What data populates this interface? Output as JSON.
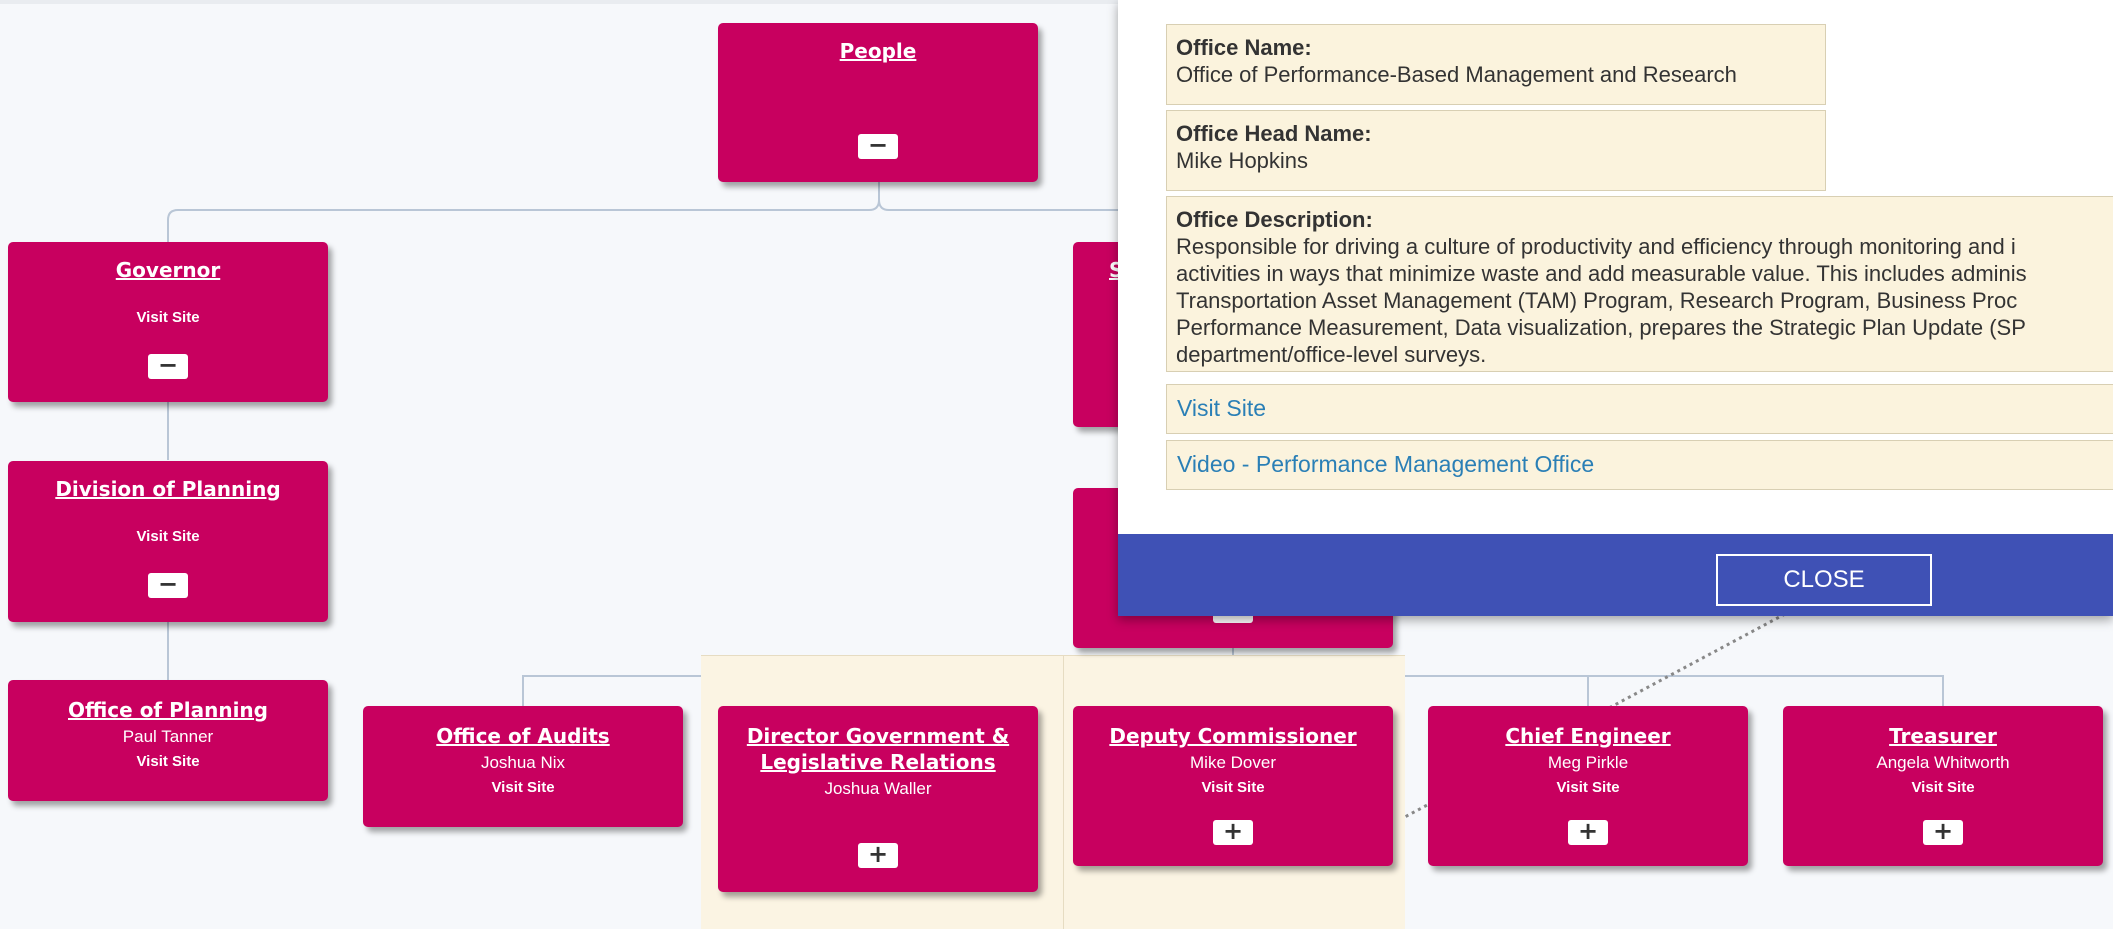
{
  "chart": {
    "nodes": {
      "people": {
        "title": "People",
        "toggle": "−"
      },
      "governor": {
        "title": "Governor",
        "visit": "Visit Site",
        "toggle": "−"
      },
      "planning_div": {
        "title": "Division of Planning",
        "visit": "Visit Site",
        "toggle": "−"
      },
      "planning_office": {
        "title": "Office of Planning",
        "head": "Paul Tanner",
        "visit": "Visit Site"
      },
      "audits": {
        "title": "Office of Audits",
        "head": "Joshua Nix",
        "visit": "Visit Site"
      },
      "gov_relations": {
        "title": "Director Government & Legislative Relations",
        "head": "Joshua Waller",
        "toggle": "+"
      },
      "deputy": {
        "title": "Deputy Commissioner",
        "head": "Mike Dover",
        "visit": "Visit Site",
        "toggle": "+"
      },
      "chief_engineer": {
        "title": "Chief Engineer",
        "head": "Meg Pirkle",
        "visit": "Visit Site",
        "toggle": "+"
      },
      "treasurer": {
        "title": "Treasurer",
        "head": "Angela Whitworth",
        "visit": "Visit Site",
        "toggle": "+"
      },
      "partial_s": {
        "title": "S"
      }
    }
  },
  "modal": {
    "office_name": {
      "label": "Office Name:",
      "value": "Office of Performance-Based Management and Research"
    },
    "office_head": {
      "label": "Office Head Name:",
      "value": "Mike Hopkins"
    },
    "office_desc": {
      "label": "Office Description:",
      "lines": [
        "Responsible for driving a culture of productivity and efficiency through monitoring and i",
        "activities in ways that minimize waste and add measurable value. This includes adminis",
        "Transportation Asset Management (TAM) Program, Research Program, Business Proc",
        "Performance Measurement, Data visualization, prepares the Strategic Plan Update (SP",
        "department/office-level surveys."
      ]
    },
    "visit_link": "Visit Site",
    "video_link": "Video - Performance Management Office",
    "close_label": "CLOSE"
  },
  "colors": {
    "node": "#c8005f",
    "modal_footer": "#3f51b5",
    "field_bg": "#fbf3dd",
    "link": "#2a7fb6"
  }
}
